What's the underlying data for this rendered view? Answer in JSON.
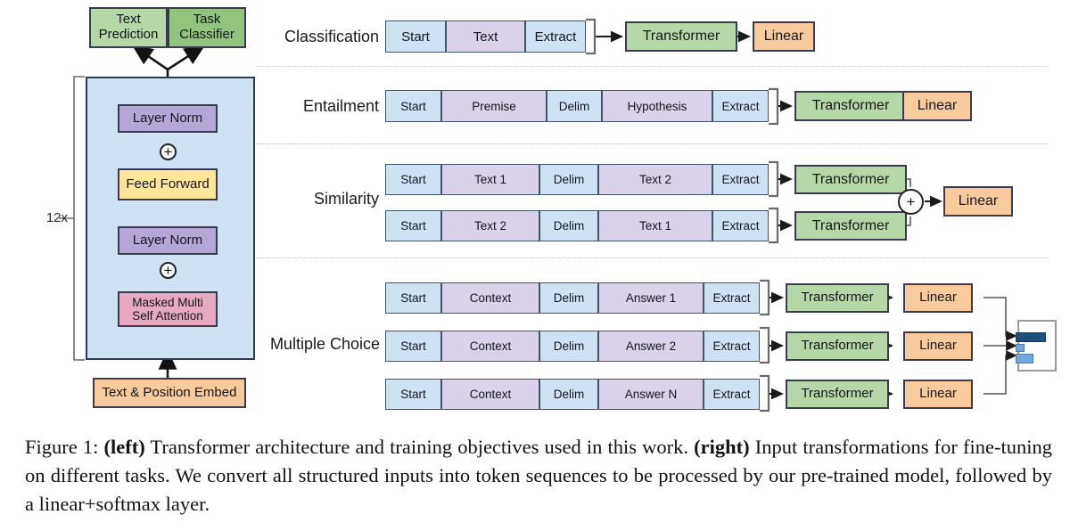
{
  "figure": {
    "caption_prefix": "Figure 1:",
    "caption_left_tag": "(left)",
    "caption_part1": " Transformer architecture and training objectives used in this work. ",
    "caption_right_tag": "(right)",
    "caption_part2": " Input transformations for fine-tuning on different tasks. We convert all structured inputs into token sequences to be processed by our pre-trained model, followed by a linear+softmax layer."
  },
  "architecture": {
    "heads": [
      {
        "label": "Text\nPrediction",
        "color": "#b6d7a8"
      },
      {
        "label": "Task\nClassifier",
        "color": "#93c47d"
      }
    ],
    "repeat_label": "12x",
    "blocks": [
      {
        "label": "Layer Norm",
        "color": "#b4a7d6"
      },
      {
        "label": "Feed Forward",
        "color": "#ffe599"
      },
      {
        "label": "Layer Norm",
        "color": "#b4a7d6"
      },
      {
        "label": "Masked Multi\nSelf Attention",
        "color": "#e6a9c0"
      }
    ],
    "residual_symbol": "+",
    "embedding": {
      "label": "Text & Position Embed",
      "color": "#f9cb9c"
    },
    "panel_color": "#cfe2f3"
  },
  "tasks": [
    {
      "name": "Classification",
      "rows": [
        {
          "tokens": [
            {
              "label": "Start",
              "type": "special"
            },
            {
              "label": "Text",
              "type": "content"
            },
            {
              "label": "Extract",
              "type": "special"
            }
          ],
          "transformer": "Transformer",
          "linear": "Linear"
        }
      ]
    },
    {
      "name": "Entailment",
      "rows": [
        {
          "tokens": [
            {
              "label": "Start",
              "type": "special"
            },
            {
              "label": "Premise",
              "type": "content"
            },
            {
              "label": "Delim",
              "type": "special"
            },
            {
              "label": "Hypothesis",
              "type": "content"
            },
            {
              "label": "Extract",
              "type": "special"
            }
          ],
          "transformer": "Transformer",
          "linear": "Linear"
        }
      ]
    },
    {
      "name": "Similarity",
      "merge_symbol": "+",
      "linear": "Linear",
      "rows": [
        {
          "tokens": [
            {
              "label": "Start",
              "type": "special"
            },
            {
              "label": "Text 1",
              "type": "content"
            },
            {
              "label": "Delim",
              "type": "special"
            },
            {
              "label": "Text 2",
              "type": "content"
            },
            {
              "label": "Extract",
              "type": "special"
            }
          ],
          "transformer": "Transformer"
        },
        {
          "tokens": [
            {
              "label": "Start",
              "type": "special"
            },
            {
              "label": "Text 2",
              "type": "content"
            },
            {
              "label": "Delim",
              "type": "special"
            },
            {
              "label": "Text 1",
              "type": "content"
            },
            {
              "label": "Extract",
              "type": "special"
            }
          ],
          "transformer": "Transformer"
        }
      ]
    },
    {
      "name": "Multiple Choice",
      "rows": [
        {
          "tokens": [
            {
              "label": "Start",
              "type": "special"
            },
            {
              "label": "Context",
              "type": "content"
            },
            {
              "label": "Delim",
              "type": "special"
            },
            {
              "label": "Answer 1",
              "type": "content"
            },
            {
              "label": "Extract",
              "type": "special"
            }
          ],
          "transformer": "Transformer",
          "linear": "Linear"
        },
        {
          "tokens": [
            {
              "label": "Start",
              "type": "special"
            },
            {
              "label": "Context",
              "type": "content"
            },
            {
              "label": "Delim",
              "type": "special"
            },
            {
              "label": "Answer 2",
              "type": "content"
            },
            {
              "label": "Extract",
              "type": "special"
            }
          ],
          "transformer": "Transformer",
          "linear": "Linear"
        },
        {
          "tokens": [
            {
              "label": "Start",
              "type": "special"
            },
            {
              "label": "Context",
              "type": "content"
            },
            {
              "label": "Delim",
              "type": "special"
            },
            {
              "label": "Answer N",
              "type": "content"
            },
            {
              "label": "Extract",
              "type": "special"
            }
          ],
          "transformer": "Transformer",
          "linear": "Linear"
        }
      ]
    }
  ],
  "softmax_chart": {
    "bars": [
      {
        "value": 0.72,
        "color": "#1f4e79"
      },
      {
        "value": 0.08,
        "color": "#6fa8dc"
      },
      {
        "value": 0.34,
        "color": "#6fa8dc"
      }
    ]
  },
  "colors": {
    "special_token": "#cfe2f3",
    "content_token": "#d9d2e9",
    "transformer": "#b6d7a8",
    "linear": "#f9cb9c",
    "separator": "#c3c3c8",
    "stroke": "#3b3b4f"
  }
}
